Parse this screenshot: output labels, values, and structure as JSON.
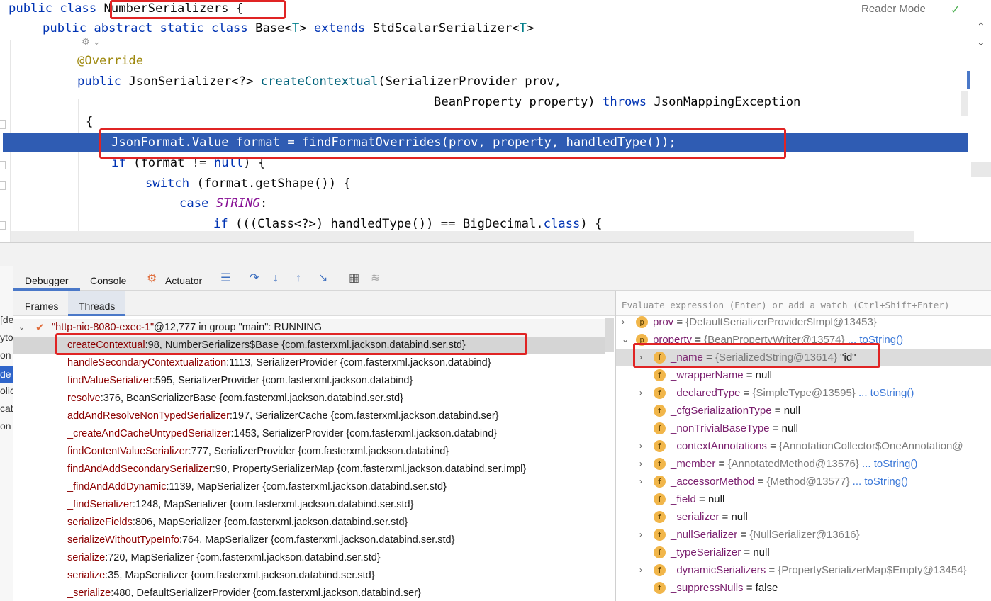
{
  "editor": {
    "reader_mode": "Reader Mode",
    "lines": {
      "l1_a": "public class ",
      "l1_b": "NumberSerializers {",
      "l2_a": "public abstract static class ",
      "l2_b": "Base<",
      "l2_c": "T",
      "l2_d": "> ",
      "l2_e": "extends ",
      "l2_f": "StdScalarSerializer<",
      "l2_g": "T",
      "l2_h": ">",
      "l3": "@Override",
      "l4_a": "public ",
      "l4_b": "JsonSerializer<?> ",
      "l4_c": "createContextual",
      "l4_d": "(SerializerProvider prov,",
      "l5_a": "BeanProperty property) ",
      "l5_b": "throws ",
      "l5_c": "JsonMappingException",
      "l6": "{",
      "l7": "JsonFormat.Value format = findFormatOverrides(prov, property, handledType());",
      "l8_a": "if ",
      "l8_b": "(format != ",
      "l8_c": "null",
      "l8_d": ") {",
      "l9_a": "switch ",
      "l9_b": "(format.getShape()) {",
      "l10_a": "case ",
      "l10_b": "STRING",
      "l10_c": ":",
      "l11_a": "if ",
      "l11_b": "(((Class<?>) handledType()) == BigDecimal.",
      "l11_c": "class",
      "l11_d": ") {"
    }
  },
  "toolbar": {
    "tab_debugger": "Debugger",
    "tab_console": "Console",
    "tab_actuator": "Actuator"
  },
  "left_strip": [
    "[de",
    "yto",
    "on",
    "de",
    "olic",
    "cat",
    "on"
  ],
  "frames": {
    "tab_frames": "Frames",
    "tab_threads": "Threads",
    "thread_name": "\"http-nio-8080-exec-1\"",
    "thread_rest": "@12,777 in group \"main\": RUNNING",
    "rows": [
      {
        "method": "createContextual",
        "loc": ":98, NumberSerializers$Base {com.fasterxml.jackson.databind.ser.std}"
      },
      {
        "method": "handleSecondaryContextualization",
        "loc": ":1113, SerializerProvider {com.fasterxml.jackson.databind}"
      },
      {
        "method": "findValueSerializer",
        "loc": ":595, SerializerProvider {com.fasterxml.jackson.databind}"
      },
      {
        "method": "resolve",
        "loc": ":376, BeanSerializerBase {com.fasterxml.jackson.databind.ser.std}"
      },
      {
        "method": "addAndResolveNonTypedSerializer",
        "loc": ":197, SerializerCache {com.fasterxml.jackson.databind.ser}"
      },
      {
        "method": "_createAndCacheUntypedSerializer",
        "loc": ":1453, SerializerProvider {com.fasterxml.jackson.databind}"
      },
      {
        "method": "findContentValueSerializer",
        "loc": ":777, SerializerProvider {com.fasterxml.jackson.databind}"
      },
      {
        "method": "findAndAddSecondarySerializer",
        "loc": ":90, PropertySerializerMap {com.fasterxml.jackson.databind.ser.impl}"
      },
      {
        "method": "_findAndAddDynamic",
        "loc": ":1139, MapSerializer {com.fasterxml.jackson.databind.ser.std}"
      },
      {
        "method": "_findSerializer",
        "loc": ":1248, MapSerializer {com.fasterxml.jackson.databind.ser.std}"
      },
      {
        "method": "serializeFields",
        "loc": ":806, MapSerializer {com.fasterxml.jackson.databind.ser.std}"
      },
      {
        "method": "serializeWithoutTypeInfo",
        "loc": ":764, MapSerializer {com.fasterxml.jackson.databind.ser.std}"
      },
      {
        "method": "serialize",
        "loc": ":720, MapSerializer {com.fasterxml.jackson.databind.ser.std}"
      },
      {
        "method": "serialize",
        "loc": ":35, MapSerializer {com.fasterxml.jackson.databind.ser.std}"
      },
      {
        "method": "_serialize",
        "loc": ":480, DefaultSerializerProvider {com.fasterxml.jackson.databind.ser}"
      }
    ]
  },
  "variables": {
    "eval_placeholder": "Evaluate expression (Enter) or add a watch (Ctrl+Shift+Enter)",
    "rows": [
      {
        "badge": "p",
        "name": "prov",
        "eq": " = ",
        "type": "{DefaultSerializerProvider$Impl@13453}",
        "link": "",
        "val": ""
      },
      {
        "badge": "p",
        "name": "property",
        "eq": " = ",
        "type": "{BeanPropertyWriter@13574}",
        "link": " ... toString()",
        "val": ""
      },
      {
        "badge": "f",
        "name": "_name",
        "eq": " = ",
        "type": "{SerializedString@13614} ",
        "link": "",
        "val": "\"id\""
      },
      {
        "badge": "f",
        "name": "_wrapperName",
        "eq": " = ",
        "type": "",
        "link": "",
        "val": "null"
      },
      {
        "badge": "f",
        "name": "_declaredType",
        "eq": " = ",
        "type": "{SimpleType@13595}",
        "link": " ... toString()",
        "val": ""
      },
      {
        "badge": "f",
        "name": "_cfgSerializationType",
        "eq": " = ",
        "type": "",
        "link": "",
        "val": "null"
      },
      {
        "badge": "f",
        "name": "_nonTrivialBaseType",
        "eq": " = ",
        "type": "",
        "link": "",
        "val": "null"
      },
      {
        "badge": "f",
        "name": "_contextAnnotations",
        "eq": " = ",
        "type": "{AnnotationCollector$OneAnnotation@",
        "link": "",
        "val": ""
      },
      {
        "badge": "f",
        "name": "_member",
        "eq": " = ",
        "type": "{AnnotatedMethod@13576}",
        "link": " ... toString()",
        "val": ""
      },
      {
        "badge": "f",
        "name": "_accessorMethod",
        "eq": " = ",
        "type": "{Method@13577}",
        "link": " ... toString()",
        "val": ""
      },
      {
        "badge": "f",
        "name": "_field",
        "eq": " = ",
        "type": "",
        "link": "",
        "val": "null"
      },
      {
        "badge": "f",
        "name": "_serializer",
        "eq": " = ",
        "type": "",
        "link": "",
        "val": "null"
      },
      {
        "badge": "f",
        "name": "_nullSerializer",
        "eq": " = ",
        "type": "{NullSerializer@13616}",
        "link": "",
        "val": ""
      },
      {
        "badge": "f",
        "name": "_typeSerializer",
        "eq": " = ",
        "type": "",
        "link": "",
        "val": "null"
      },
      {
        "badge": "f",
        "name": "_dynamicSerializers",
        "eq": " = ",
        "type": "{PropertySerializerMap$Empty@13454}",
        "link": "",
        "val": ""
      },
      {
        "badge": "f",
        "name": "_suppressNulls",
        "eq": " = ",
        "type": "",
        "link": "",
        "val": "false"
      }
    ]
  }
}
